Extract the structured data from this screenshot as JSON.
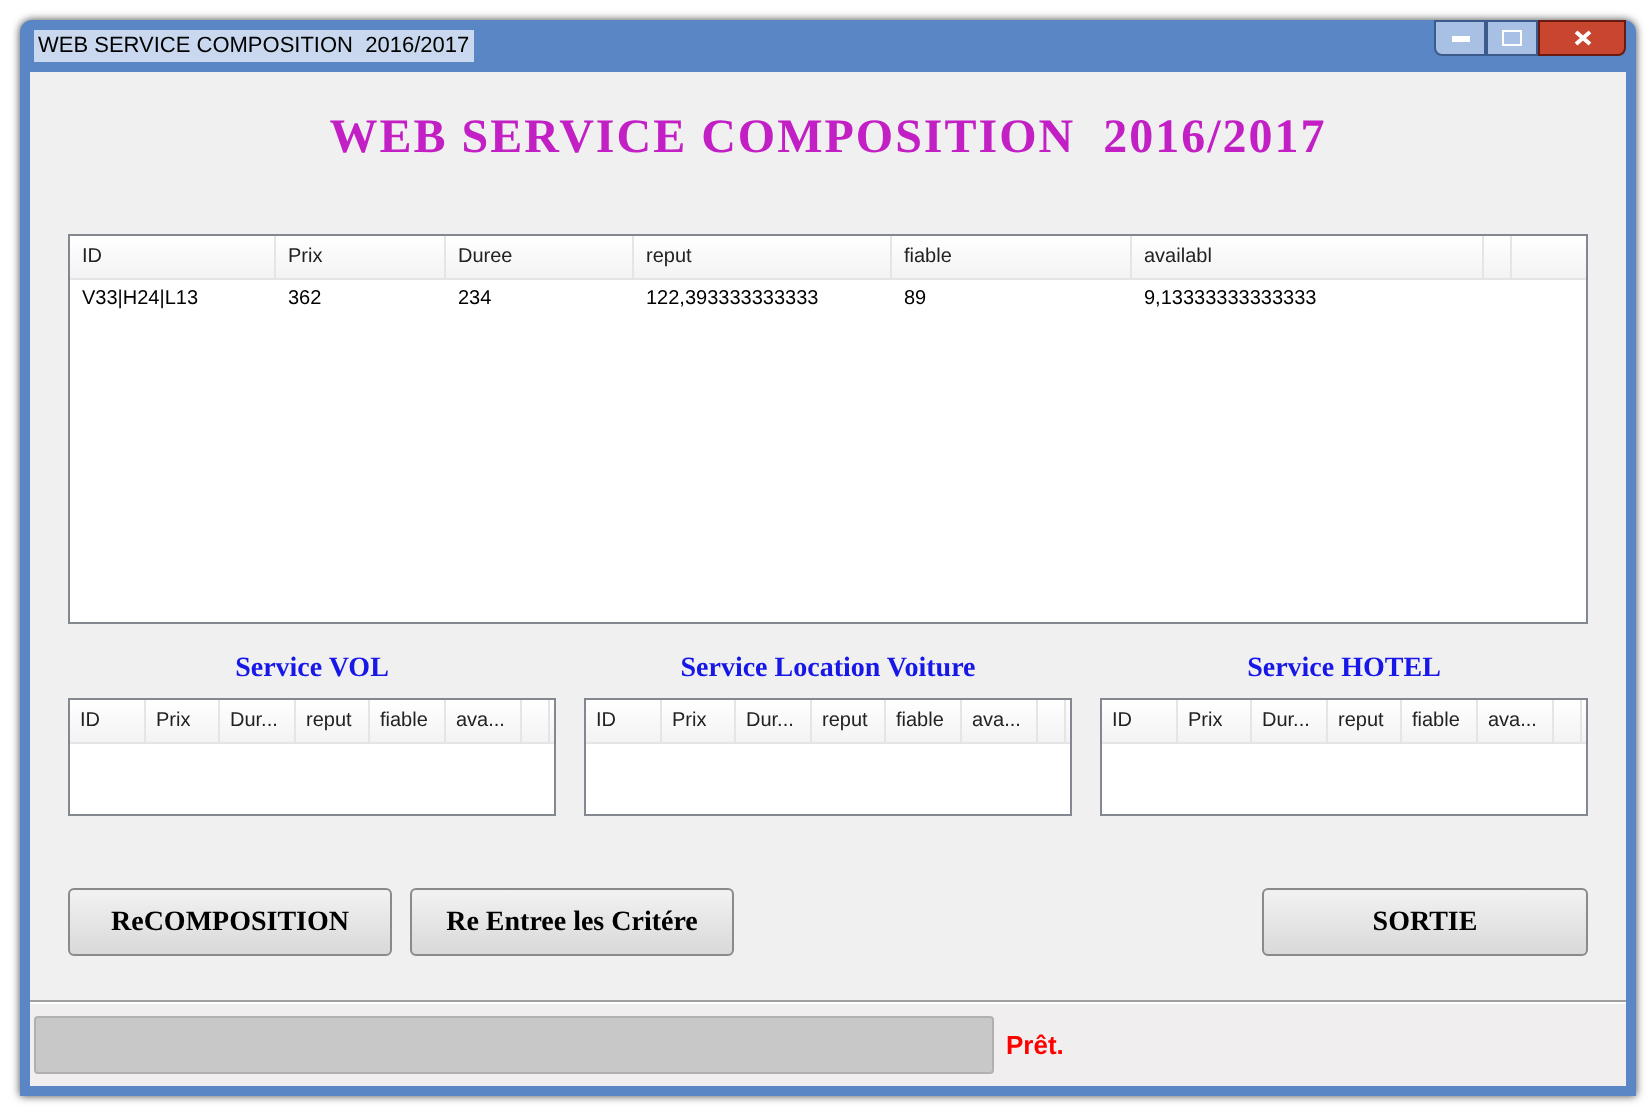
{
  "window": {
    "title": "WEB SERVICE COMPOSITION  2016/2017"
  },
  "heading": "WEB SERVICE COMPOSITION  2016/2017",
  "main_table": {
    "columns": [
      "ID",
      "Prix",
      "Duree",
      "reput",
      "fiable",
      "availabl"
    ],
    "rows": [
      [
        "V33|H24|L13",
        "362",
        "234",
        "122,393333333333",
        "89",
        "9,13333333333333"
      ]
    ]
  },
  "service_tables": [
    {
      "title": "Service VOL",
      "columns": [
        "ID",
        "Prix",
        "Dur...",
        "reput",
        "fiable",
        "ava..."
      ]
    },
    {
      "title": "Service Location Voiture",
      "columns": [
        "ID",
        "Prix",
        "Dur...",
        "reput",
        "fiable",
        "ava..."
      ]
    },
    {
      "title": "Service HOTEL",
      "columns": [
        "ID",
        "Prix",
        "Dur...",
        "reput",
        "fiable",
        "ava..."
      ]
    }
  ],
  "left_buttons": [
    "ReCOMPOSITION",
    "Re Entree les Critére"
  ],
  "right_buttons": [
    "SORTIE"
  ],
  "status_bar": {
    "text": "Prêt."
  }
}
